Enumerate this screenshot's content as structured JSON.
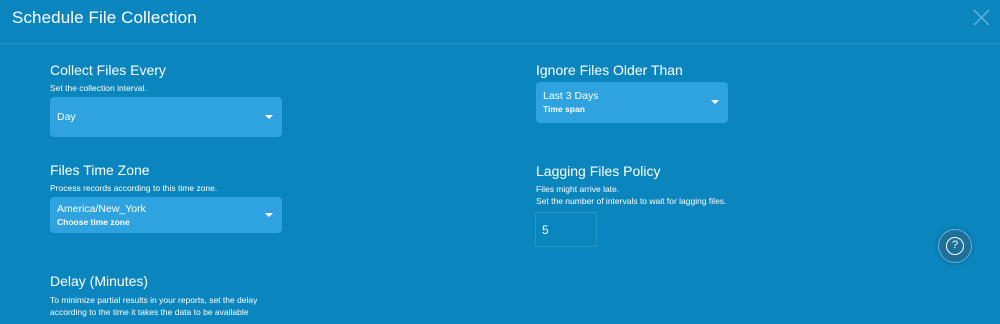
{
  "dialog": {
    "title": "Schedule File Collection"
  },
  "collect_interval": {
    "label": "Collect Files Every",
    "description": "Set the collection interval.",
    "value": "Day"
  },
  "ignore_older": {
    "label": "Ignore Files Older Than",
    "value": "Last 3 Days",
    "sublabel": "Time span"
  },
  "time_zone": {
    "label": "Files Time Zone",
    "description": "Process records according to this time zone.",
    "value": "America/New_York",
    "sublabel": "Choose time zone"
  },
  "lagging_policy": {
    "label": "Lagging Files Policy",
    "description_line1": "Files might arrive late.",
    "description_line2": "Set the number of intervals to wait for lagging files.",
    "value": "5"
  },
  "delay": {
    "label": "Delay (Minutes)",
    "description_line1": "To minimize partial results in your reports, set the delay",
    "description_line2": "according to the time it takes the data to be available"
  },
  "help": {
    "glyph": "?"
  },
  "icons": {
    "close": "close-icon",
    "caret": "chevron-down-icon",
    "help": "help-icon"
  },
  "colors": {
    "background": "#0a85bd",
    "select_fill": "#2ea3e0",
    "text": "#ffffff"
  }
}
